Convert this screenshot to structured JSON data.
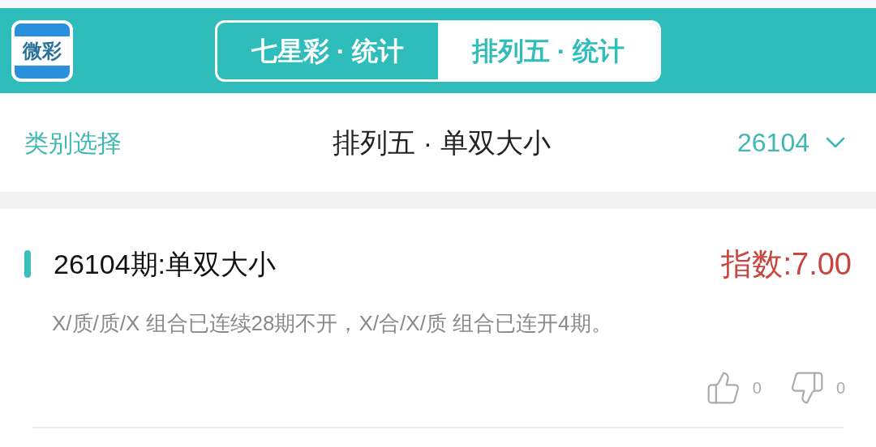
{
  "header": {
    "logo_text": "微彩",
    "tabs": [
      {
        "label": "七星彩 · 统计",
        "selected": false
      },
      {
        "label": "排列五 · 统计",
        "selected": true
      }
    ]
  },
  "subheader": {
    "category_link": "类别选择",
    "title": "排列五 · 单双大小",
    "period": "26104"
  },
  "card": {
    "title": "26104期:单双大小",
    "index": "指数:7.00",
    "description": "X/质/质/X 组合已连续28期不开，X/合/X/质 组合已连开4期。",
    "likes": "0",
    "dislikes": "0"
  }
}
